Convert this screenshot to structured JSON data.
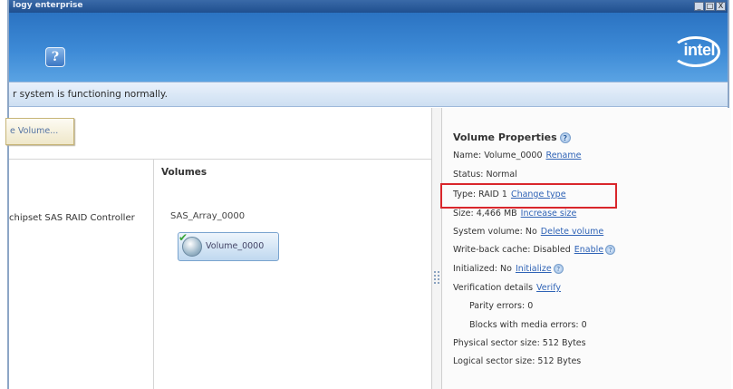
{
  "window": {
    "title": "logy enterprise",
    "controls": [
      "_",
      "□",
      "X"
    ]
  },
  "header": {
    "help_label": "?",
    "logo_text": "intel"
  },
  "status": {
    "text": "r system is functioning normally."
  },
  "toolbar": {
    "create_label": "e Volume..."
  },
  "controller": {
    "label": "chipset SAS RAID Controller"
  },
  "volumes": {
    "heading": "Volumes",
    "array_name": "SAS_Array_0000",
    "volume_name": "Volume_0000"
  },
  "properties": {
    "title": "Volume Properties",
    "name_label": "Name: Volume_0000",
    "name_action": "Rename",
    "status_label": "Status: Normal",
    "type_label": "Type: RAID 1",
    "type_action": "Change type",
    "size_label": "Size: 4,466 MB",
    "size_action": "Increase size",
    "system_label": "System volume: No",
    "system_action": "Delete volume",
    "writeback_label": "Write-back cache: Disabled",
    "writeback_action": "Enable",
    "initialized_label": "Initialized: No",
    "initialized_action": "Initialize",
    "verification_label": "Verification details",
    "verification_action": "Verify",
    "parity_errors": "Parity errors: 0",
    "media_errors": "Blocks with media errors: 0",
    "physical_sector": "Physical sector size: 512 Bytes",
    "logical_sector": "Logical sector size: 512 Bytes"
  },
  "colors": {
    "header_blue": "#3d8ad6",
    "link_blue": "#2f63b6",
    "highlight_red": "#d9262b"
  }
}
